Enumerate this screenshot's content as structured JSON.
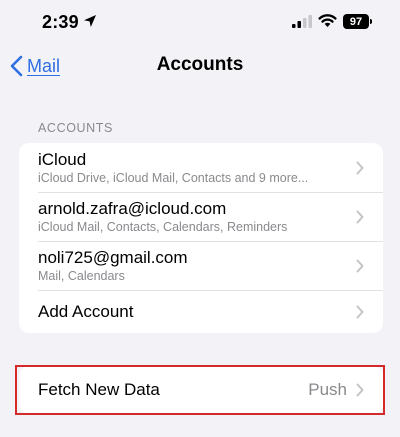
{
  "status_bar": {
    "time": "2:39",
    "battery": "97",
    "icons": [
      "location-arrow-icon",
      "cellular-signal-icon",
      "wifi-icon",
      "battery-icon"
    ]
  },
  "nav": {
    "back_label": "Mail",
    "title": "Accounts"
  },
  "accounts_section": {
    "header": "ACCOUNTS",
    "items": [
      {
        "title": "iCloud",
        "subtitle": "iCloud Drive, iCloud Mail, Contacts and 9 more..."
      },
      {
        "title": "arnold.zafra@icloud.com",
        "subtitle": "iCloud Mail, Contacts, Calendars, Reminders"
      },
      {
        "title": "noli725@gmail.com",
        "subtitle": "Mail, Calendars"
      }
    ],
    "add_account_label": "Add Account"
  },
  "fetch": {
    "label": "Fetch New Data",
    "value": "Push"
  },
  "colors": {
    "accent": "#2f6fe4",
    "background": "#f2f2f7",
    "secondary_text": "#8a8a8e",
    "highlight": "#d42a2a"
  }
}
